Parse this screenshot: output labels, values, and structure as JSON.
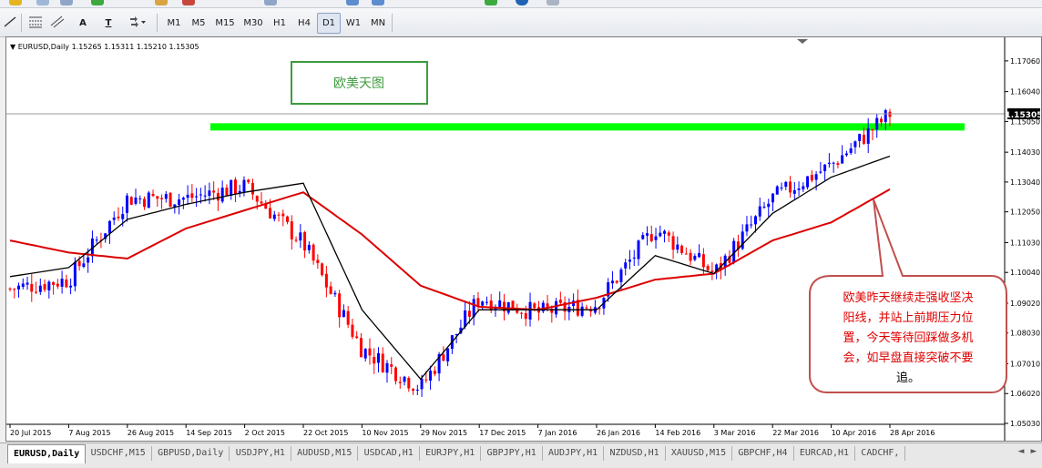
{
  "toolbar": {
    "timeframes": [
      "M1",
      "M5",
      "M15",
      "M30",
      "H1",
      "H4",
      "D1",
      "W1",
      "MN"
    ],
    "active_timeframe": "D1",
    "text_tool_label": "A",
    "text_label_tool_label": "T"
  },
  "chart": {
    "header": "▼ EURUSD,Daily  1.15265 1.15311 1.15210 1.15305",
    "title_box": "欧美天图",
    "current_price_label": "1.15305",
    "price_axis": [
      "1.17060",
      "1.16040",
      "1.15050",
      "1.14030",
      "1.13040",
      "1.12050",
      "1.11030",
      "1.10040",
      "1.09020",
      "1.08030",
      "1.07010",
      "1.06020",
      "1.05030"
    ],
    "date_axis": [
      "20 Jul 2015",
      "7 Aug 2015",
      "26 Aug 2015",
      "14 Sep 2015",
      "2 Oct 2015",
      "22 Oct 2015",
      "10 Nov 2015",
      "29 Nov 2015",
      "17 Dec 2015",
      "7 Jan 2016",
      "26 Jan 2016",
      "14 Feb 2016",
      "3 Mar 2016",
      "22 Mar 2016",
      "10 Apr 2016",
      "28 Apr 2016"
    ],
    "callout_lines": [
      "欧美昨天继续走强收坚决",
      "阳线，并站上前期压力位",
      "置，今天等待回踩做多机",
      "会，如早盘直接突破不要",
      "追。"
    ],
    "colors": {
      "bull_candle": "#0000ff",
      "bear_candle": "#ff0000",
      "resistance_band": "#00ff00",
      "ma_fast": "#000000",
      "ma_slow": "#dd0000",
      "title_box_border": "#3e9b3e",
      "callout_border": "#c0504d",
      "callout_text_red": "#e00000"
    }
  },
  "tabs": [
    {
      "label": "EURUSD,Daily",
      "active": true
    },
    {
      "label": "USDCHF,M15",
      "active": false
    },
    {
      "label": "GBPUSD,Daily",
      "active": false
    },
    {
      "label": "USDJPY,H1",
      "active": false
    },
    {
      "label": "AUDUSD,M15",
      "active": false
    },
    {
      "label": "USDCAD,H1",
      "active": false
    },
    {
      "label": "EURJPY,H1",
      "active": false
    },
    {
      "label": "GBPJPY,H1",
      "active": false
    },
    {
      "label": "AUDJPY,H1",
      "active": false
    },
    {
      "label": "NZDUSD,H1",
      "active": false
    },
    {
      "label": "XAUUSD,M15",
      "active": false
    },
    {
      "label": "GBPCHF,H4",
      "active": false
    },
    {
      "label": "EURCAD,H1",
      "active": false
    },
    {
      "label": "CADCHF,",
      "active": false
    }
  ],
  "chart_data": {
    "type": "line",
    "title": "EURUSD,Daily",
    "ohlc_header": {
      "open": 1.15265,
      "high": 1.15311,
      "low": 1.1521,
      "close": 1.15305
    },
    "x": [
      "20 Jul 2015",
      "7 Aug 2015",
      "26 Aug 2015",
      "14 Sep 2015",
      "2 Oct 2015",
      "22 Oct 2015",
      "10 Nov 2015",
      "29 Nov 2015",
      "17 Dec 2015",
      "7 Jan 2016",
      "26 Jan 2016",
      "14 Feb 2016",
      "3 Mar 2016",
      "22 Mar 2016",
      "10 Apr 2016",
      "28 Apr 2016"
    ],
    "series": [
      {
        "values": [
          1.095,
          1.098,
          1.125,
          1.125,
          1.129,
          1.11,
          1.075,
          1.062,
          1.092,
          1.087,
          1.09,
          1.115,
          1.1,
          1.125,
          1.136,
          1.153
        ]
      },
      {
        "values": [
          1.099,
          1.102,
          1.118,
          1.123,
          1.127,
          1.13,
          1.088,
          1.065,
          1.088,
          1.088,
          1.088,
          1.106,
          1.1,
          1.12,
          1.132,
          1.139
        ]
      },
      {
        "values": [
          1.111,
          1.107,
          1.105,
          1.115,
          1.121,
          1.127,
          1.113,
          1.096,
          1.089,
          1.088,
          1.092,
          1.098,
          1.1,
          1.111,
          1.117,
          1.128
        ]
      }
    ],
    "resistance_zone": [
      1.148,
      1.149
    ],
    "ylim": [
      1.05,
      1.176
    ],
    "last_price": 1.15305
  }
}
